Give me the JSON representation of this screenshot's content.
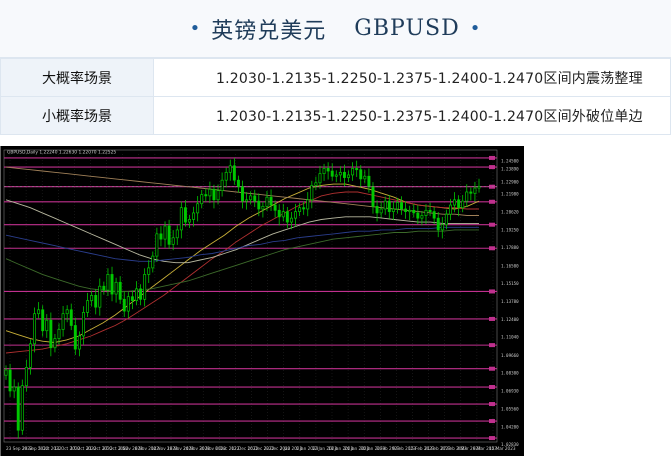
{
  "header": {
    "title_cn": "英镑兑美元",
    "title_code": "GBPUSD",
    "bullet": "•"
  },
  "scenarios": [
    {
      "label": "大概率场景",
      "levels": "1.2030-1.2135-1.2250-1.2375-1.2400-1.2470",
      "outlook": "区间内震荡整理"
    },
    {
      "label": "小概率场景",
      "levels": "1.2030-1.2135-1.2250-1.2375-1.2400-1.2470",
      "outlook": "区间外破位单边"
    }
  ],
  "chart_data": {
    "type": "candlestick",
    "symbol_label": "GBPUSD,Daily  1.22240 1.22630 1.22070 1.22525",
    "ylim": [
      1.03,
      1.25
    ],
    "y_ticks": [
      "1.24500",
      "1.23890",
      "1.22900",
      "1.21980",
      "1.20620",
      "1.19250",
      "1.17880",
      "1.16500",
      "1.15150",
      "1.13780",
      "1.12400",
      "1.11040",
      "1.09660",
      "1.08300",
      "1.06930",
      "1.05560",
      "1.04200",
      "1.02830"
    ],
    "x_ticks": [
      "23 Sep 2022",
      "29 Sep 2022",
      "5 Oct 2022",
      "11 Oct 2022",
      "17 Oct 2022",
      "21 Oct 2022",
      "27 Oct 2022",
      "2 Nov 2022",
      "8 Nov 2022",
      "14 Nov 2022",
      "18 Nov 2022",
      "24 Nov 2022",
      "30 Nov 2022",
      "6 Dec 2022",
      "12 Dec 2022",
      "16 Dec 2022",
      "22 Dec 2022",
      "2 Jan 2023",
      "6 Jan 2023",
      "12 Jan 2023",
      "18 Jan 2023",
      "24 Jan 2023",
      "30 Jan 2023",
      "3 Feb 2023",
      "9 Feb 2023",
      "15 Feb 2023",
      "21 Feb 2023",
      "27 Feb 2023",
      "3 Mar 2023",
      "9 Mar 2023",
      "15 Mar 2023"
    ],
    "horizontal_levels": [
      1.247,
      1.24,
      1.225,
      1.2135,
      1.196,
      1.178,
      1.145,
      1.124,
      1.104,
      1.086,
      1.072,
      1.059,
      1.046,
      1.033
    ],
    "closes": [
      1.085,
      1.069,
      1.072,
      1.039,
      1.073,
      1.087,
      1.105,
      1.128,
      1.131,
      1.115,
      1.123,
      1.102,
      1.109,
      1.116,
      1.128,
      1.131,
      1.119,
      1.101,
      1.111,
      1.129,
      1.138,
      1.142,
      1.133,
      1.149,
      1.146,
      1.158,
      1.143,
      1.152,
      1.139,
      1.13,
      1.141,
      1.138,
      1.147,
      1.139,
      1.158,
      1.163,
      1.172,
      1.189,
      1.185,
      1.195,
      1.181,
      1.186,
      1.192,
      1.209,
      1.198,
      1.2,
      1.205,
      1.212,
      1.219,
      1.218,
      1.223,
      1.215,
      1.222,
      1.23,
      1.236,
      1.241,
      1.23,
      1.225,
      1.214,
      1.215,
      1.218,
      1.214,
      1.208,
      1.21,
      1.217,
      1.211,
      1.207,
      1.202,
      1.206,
      1.198,
      1.201,
      1.206,
      1.209,
      1.208,
      1.215,
      1.226,
      1.228,
      1.235,
      1.239,
      1.237,
      1.233,
      1.234,
      1.236,
      1.232,
      1.234,
      1.239,
      1.238,
      1.231,
      1.233,
      1.225,
      1.21,
      1.205,
      1.208,
      1.214,
      1.206,
      1.208,
      1.213,
      1.208,
      1.206,
      1.207,
      1.205,
      1.201,
      1.203,
      1.207,
      1.206,
      1.201,
      1.192,
      1.196,
      1.204,
      1.211,
      1.215,
      1.209,
      1.214,
      1.221,
      1.22,
      1.224,
      1.2252
    ],
    "ma_series": [
      {
        "color": "#c9b038",
        "values": [
          1.115,
          1.112,
          1.109,
          1.107,
          1.106,
          1.108,
          1.111,
          1.116,
          1.121,
          1.127,
          1.134,
          1.141,
          1.148,
          1.155,
          1.162,
          1.169,
          1.176,
          1.182,
          1.188,
          1.195,
          1.201,
          1.206,
          1.211,
          1.216,
          1.22,
          1.224,
          1.226,
          1.227,
          1.227,
          1.225,
          1.223,
          1.22,
          1.217,
          1.213,
          1.211,
          1.21,
          1.209,
          1.208,
          1.21,
          1.214
        ]
      },
      {
        "color": "#b03030",
        "values": [
          1.098,
          1.099,
          1.1,
          1.101,
          1.103,
          1.105,
          1.108,
          1.111,
          1.115,
          1.119,
          1.124,
          1.13,
          1.136,
          1.142,
          1.149,
          1.156,
          1.163,
          1.17,
          1.176,
          1.183,
          1.189,
          1.195,
          1.2,
          1.205,
          1.21,
          1.214,
          1.218,
          1.22,
          1.221,
          1.221,
          1.219,
          1.217,
          1.215,
          1.213,
          1.211,
          1.21,
          1.209,
          1.209,
          1.208,
          1.208
        ]
      },
      {
        "color": "#b8b8a0",
        "values": [
          1.215,
          1.212,
          1.209,
          1.205,
          1.201,
          1.197,
          1.193,
          1.189,
          1.185,
          1.181,
          1.177,
          1.173,
          1.17,
          1.168,
          1.167,
          1.167,
          1.169,
          1.171,
          1.174,
          1.177,
          1.181,
          1.185,
          1.189,
          1.192,
          1.195,
          1.198,
          1.2,
          1.201,
          1.202,
          1.202,
          1.202,
          1.201,
          1.2,
          1.199,
          1.198,
          1.198,
          1.197,
          1.197,
          1.197,
          1.197
        ]
      },
      {
        "color": "#2a3d8c",
        "values": [
          1.188,
          1.186,
          1.184,
          1.182,
          1.18,
          1.178,
          1.176,
          1.174,
          1.172,
          1.17,
          1.169,
          1.168,
          1.168,
          1.169,
          1.17,
          1.171,
          1.173,
          1.174,
          1.176,
          1.178,
          1.18,
          1.181,
          1.183,
          1.184,
          1.186,
          1.187,
          1.188,
          1.189,
          1.19,
          1.191,
          1.191,
          1.192,
          1.192,
          1.193,
          1.193,
          1.193,
          1.194,
          1.194,
          1.194,
          1.194
        ]
      },
      {
        "color": "#3c6a2a",
        "values": [
          1.17,
          1.166,
          1.162,
          1.158,
          1.155,
          1.152,
          1.149,
          1.147,
          1.146,
          1.145,
          1.145,
          1.146,
          1.147,
          1.149,
          1.151,
          1.153,
          1.156,
          1.159,
          1.162,
          1.165,
          1.168,
          1.171,
          1.174,
          1.177,
          1.179,
          1.181,
          1.183,
          1.185,
          1.186,
          1.187,
          1.188,
          1.189,
          1.19,
          1.19,
          1.191,
          1.191,
          1.191,
          1.192,
          1.192,
          1.192
        ]
      },
      {
        "color": "#a08058",
        "values": [
          1.24,
          1.239,
          1.238,
          1.237,
          1.236,
          1.235,
          1.234,
          1.233,
          1.232,
          1.231,
          1.23,
          1.229,
          1.228,
          1.227,
          1.226,
          1.225,
          1.224,
          1.223,
          1.222,
          1.221,
          1.22,
          1.219,
          1.218,
          1.217,
          1.216,
          1.215,
          1.214,
          1.213,
          1.212,
          1.211,
          1.21,
          1.209,
          1.208,
          1.207,
          1.206,
          1.205,
          1.204,
          1.204,
          1.203,
          1.203
        ]
      }
    ],
    "colors": {
      "background": "#000000",
      "bull": "#00c800",
      "bear": "#00c800",
      "level": "#c0308e",
      "axis_text": "#c8c8c8",
      "frame": "#7a7a7a"
    }
  }
}
